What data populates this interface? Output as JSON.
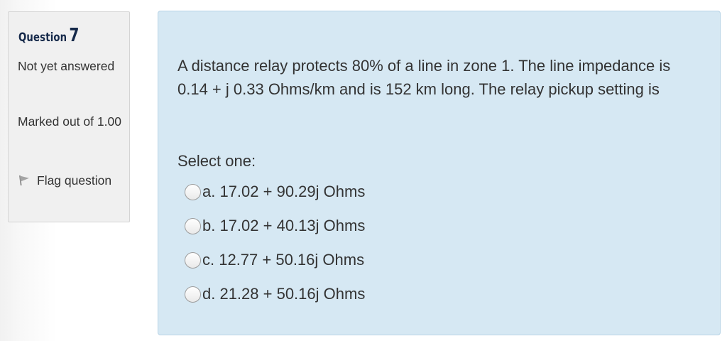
{
  "question_info": {
    "label": "Question",
    "number": "7",
    "state": "Not yet answered",
    "grade": "Marked out of 1.00",
    "flag_label": "Flag question",
    "flag_icon": "flag-icon"
  },
  "question": {
    "text": "A distance relay protects 80% of a line in zone 1.  The line impedance is 0.14 + j 0.33 Ohms/km and is 152 km long. The relay pickup setting is",
    "prompt": "Select one:",
    "options": [
      {
        "label": "a. 17.02 + 90.29j Ohms",
        "selected": false
      },
      {
        "label": "b. 17.02 + 40.13j Ohms",
        "selected": false
      },
      {
        "label": "c. 12.77 + 50.16j Ohms",
        "selected": false
      },
      {
        "label": "d. 21.28 + 50.16j Ohms",
        "selected": false
      }
    ]
  },
  "colors": {
    "info_panel_bg": "#f0f0f0",
    "content_panel_bg": "#d6e8f3",
    "heading_text": "#15294a",
    "body_text": "#333333"
  }
}
